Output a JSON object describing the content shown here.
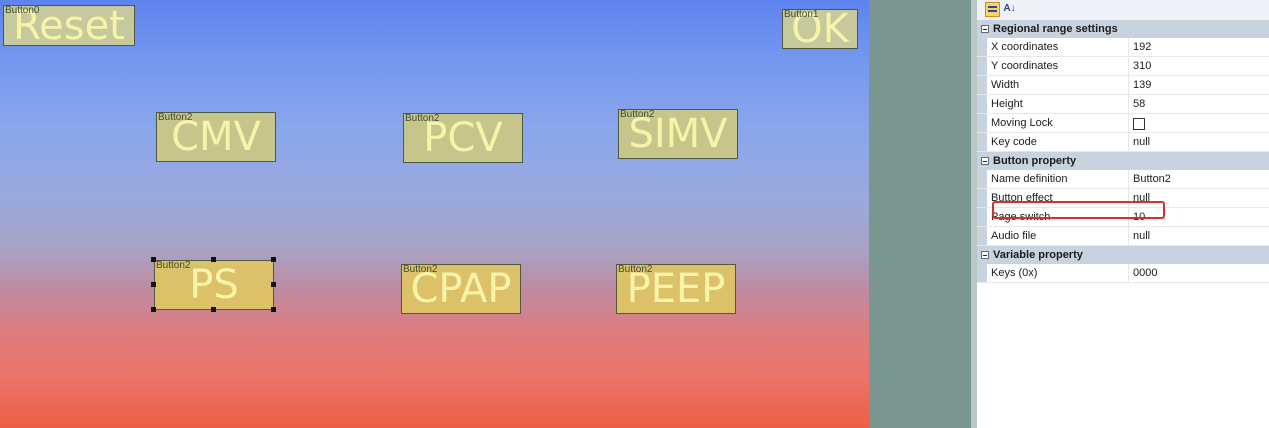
{
  "canvas": {
    "buttons": [
      {
        "id": "reset",
        "tag": "Button0",
        "label": "Reset"
      },
      {
        "id": "ok",
        "tag": "Button1",
        "label": "OK"
      },
      {
        "id": "cmv",
        "tag": "Button2",
        "label": "CMV"
      },
      {
        "id": "pcv",
        "tag": "Button2",
        "label": "PCV"
      },
      {
        "id": "simv",
        "tag": "Button2",
        "label": "SIMV"
      },
      {
        "id": "ps",
        "tag": "Button2",
        "label": "PS"
      },
      {
        "id": "cpap",
        "tag": "Button2",
        "label": "CPAP"
      },
      {
        "id": "peep",
        "tag": "Button2",
        "label": "PEEP"
      }
    ]
  },
  "panel": {
    "toolbar": {
      "categorized_icon": "categorized-icon",
      "sort_icon": "alphabetical-sort-icon",
      "sort_glyph": "A↓"
    },
    "categories": [
      {
        "title": "Regional range settings",
        "props": [
          {
            "name": "X coordinates",
            "value": "192"
          },
          {
            "name": "Y coordinates",
            "value": "310"
          },
          {
            "name": "Width",
            "value": "139"
          },
          {
            "name": "Height",
            "value": "58"
          },
          {
            "name": "Moving Lock",
            "value": ""
          },
          {
            "name": "Key code",
            "value": "null"
          }
        ]
      },
      {
        "title": "Button property",
        "props": [
          {
            "name": "Name definition",
            "value": "Button2"
          },
          {
            "name": "Button effect",
            "value": "null"
          },
          {
            "name": "Page switch",
            "value": "10"
          },
          {
            "name": "Audio file",
            "value": "null"
          }
        ]
      },
      {
        "title": "Variable property",
        "props": [
          {
            "name": "Keys (0x)",
            "value": "0000"
          }
        ]
      }
    ],
    "highlight_color": "#d2322d"
  }
}
